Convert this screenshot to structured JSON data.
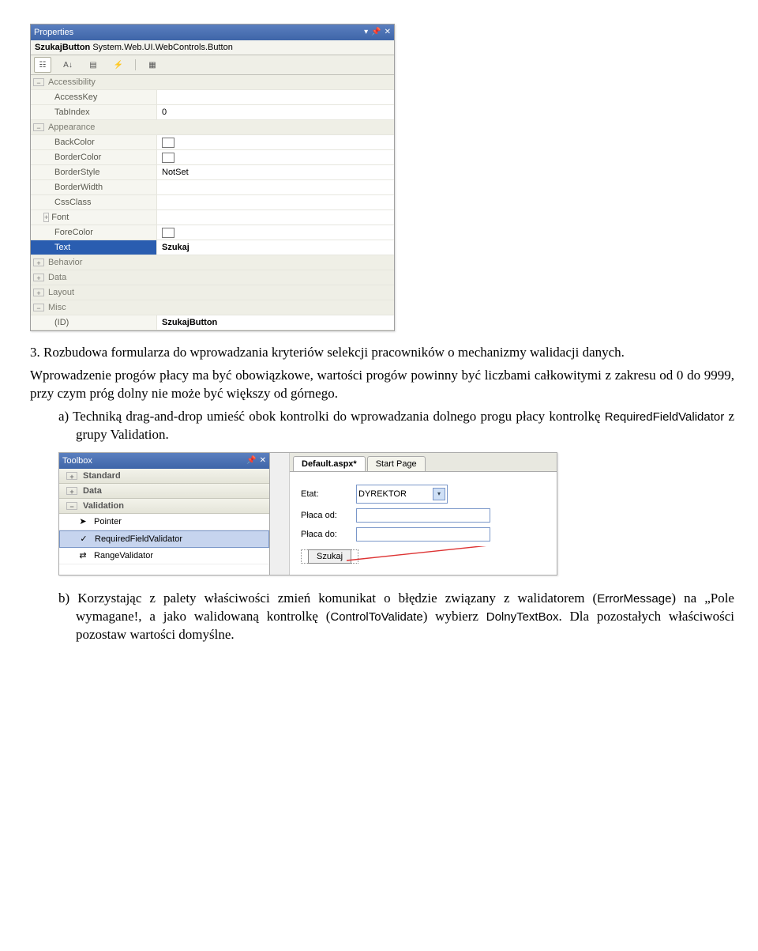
{
  "properties_panel": {
    "title": "Properties",
    "object_name": "SzukajButton",
    "object_type": "System.Web.UI.WebControls.Button",
    "categories": [
      {
        "exp": "-",
        "name": "Accessibility",
        "rows": [
          {
            "key": "AccessKey",
            "val": ""
          },
          {
            "key": "TabIndex",
            "val": "0"
          }
        ]
      },
      {
        "exp": "-",
        "name": "Appearance",
        "rows": [
          {
            "key": "BackColor",
            "swatch": true,
            "val": ""
          },
          {
            "key": "BorderColor",
            "swatch": true,
            "val": ""
          },
          {
            "key": "BorderStyle",
            "val": "NotSet"
          },
          {
            "key": "BorderWidth",
            "val": ""
          },
          {
            "key": "CssClass",
            "val": ""
          },
          {
            "key": "Font",
            "exp": "+",
            "val": ""
          },
          {
            "key": "ForeColor",
            "swatch": true,
            "val": ""
          },
          {
            "key": "Text",
            "val": "Szukaj",
            "selected": true
          }
        ]
      },
      {
        "exp": "+",
        "name": "Behavior",
        "rows": []
      },
      {
        "exp": "+",
        "name": "Data",
        "rows": []
      },
      {
        "exp": "+",
        "name": "Layout",
        "rows": []
      },
      {
        "exp": "-",
        "name": "Misc",
        "rows": [
          {
            "key": "(ID)",
            "val": "SzukajButton",
            "bold": true
          }
        ]
      }
    ]
  },
  "text": {
    "para3": "3. Rozbudowa formularza do wprowadzania kryteriów selekcji pracowników o mechanizmy walidacji danych.",
    "para3b": "Wprowadzenie progów płacy ma być obowiązkowe, wartości progów powinny być liczbami całkowitymi z zakresu od 0 do 9999, przy czym próg dolny nie może być większy od górnego.",
    "item_a": "a)  Techniką drag-and-drop umieść obok kontrolki do wprowadzania dolnego progu płacy kontrolkę ",
    "item_a_code": "RequiredFieldValidator",
    "item_a_tail": " z grupy Validation.",
    "item_b": "b)  Korzystając z palety właściwości zmień komunikat o błędzie związany z walidatorem (",
    "item_b_c1": "ErrorMessage",
    "item_b_m": ") na „Pole wymagane!, a jako walidowaną kontrolkę (",
    "item_b_c2": "ControlToValidate",
    "item_b_m2": ") wybierz ",
    "item_b_c3": "DolnyTextBox",
    "item_b_tail": ". Dla pozostałych właściwości pozostaw wartości domyślne."
  },
  "toolbox": {
    "title": "Toolbox",
    "cats": [
      {
        "exp": "+",
        "name": "Standard"
      },
      {
        "exp": "+",
        "name": "Data"
      },
      {
        "exp": "-",
        "name": "Validation"
      }
    ],
    "items": [
      {
        "icon": "pointer",
        "label": "Pointer"
      },
      {
        "icon": "rfv",
        "label": "RequiredFieldValidator",
        "selected": true
      },
      {
        "icon": "rng",
        "label": "RangeValidator"
      }
    ]
  },
  "editor": {
    "tabs": [
      {
        "label": "Default.aspx*",
        "active": true
      },
      {
        "label": "Start Page",
        "active": false
      }
    ],
    "etat_label": "Etat:",
    "etat_value": "DYREKTOR",
    "placa_od_label": "Płaca od:",
    "placa_do_label": "Płaca do:",
    "button_label": "Szukaj"
  }
}
